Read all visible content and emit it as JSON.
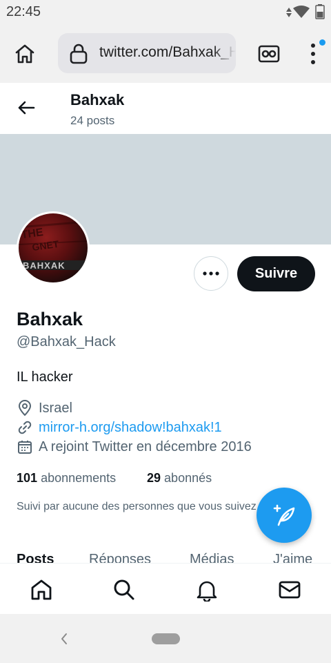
{
  "status_bar": {
    "time": "22:45"
  },
  "browser": {
    "url": "twitter.com/Bahxak_Hack"
  },
  "topbar": {
    "name": "Bahxak",
    "posts": "24 posts"
  },
  "profile": {
    "display_name": "Bahxak",
    "handle": "@Bahxak_Hack",
    "bio": "IL hacker",
    "location": "Israel",
    "website": "mirror-h.org/shadow!bahxak!1",
    "joined": "A rejoint Twitter en décembre 2016",
    "following_count": "101",
    "following_label": "abonnements",
    "followers_count": "29",
    "followers_label": "abonnés",
    "followed_by": "Suivi par aucune des personnes que vous suivez",
    "follow_label": "Suivre"
  },
  "tabs": [
    {
      "label": "Posts"
    },
    {
      "label": "Réponses"
    },
    {
      "label": "Médias"
    },
    {
      "label": "J'aime"
    }
  ],
  "colors": {
    "accent": "#1d9bf0",
    "text_primary": "#0f1419",
    "text_secondary": "#536471",
    "banner": "#cfd9de"
  },
  "icons": {
    "browser": [
      "home-icon",
      "lock-icon",
      "incognito-icon",
      "more-vert-icon"
    ],
    "nav": [
      "home-icon",
      "search-icon",
      "bell-icon",
      "mail-icon"
    ]
  }
}
